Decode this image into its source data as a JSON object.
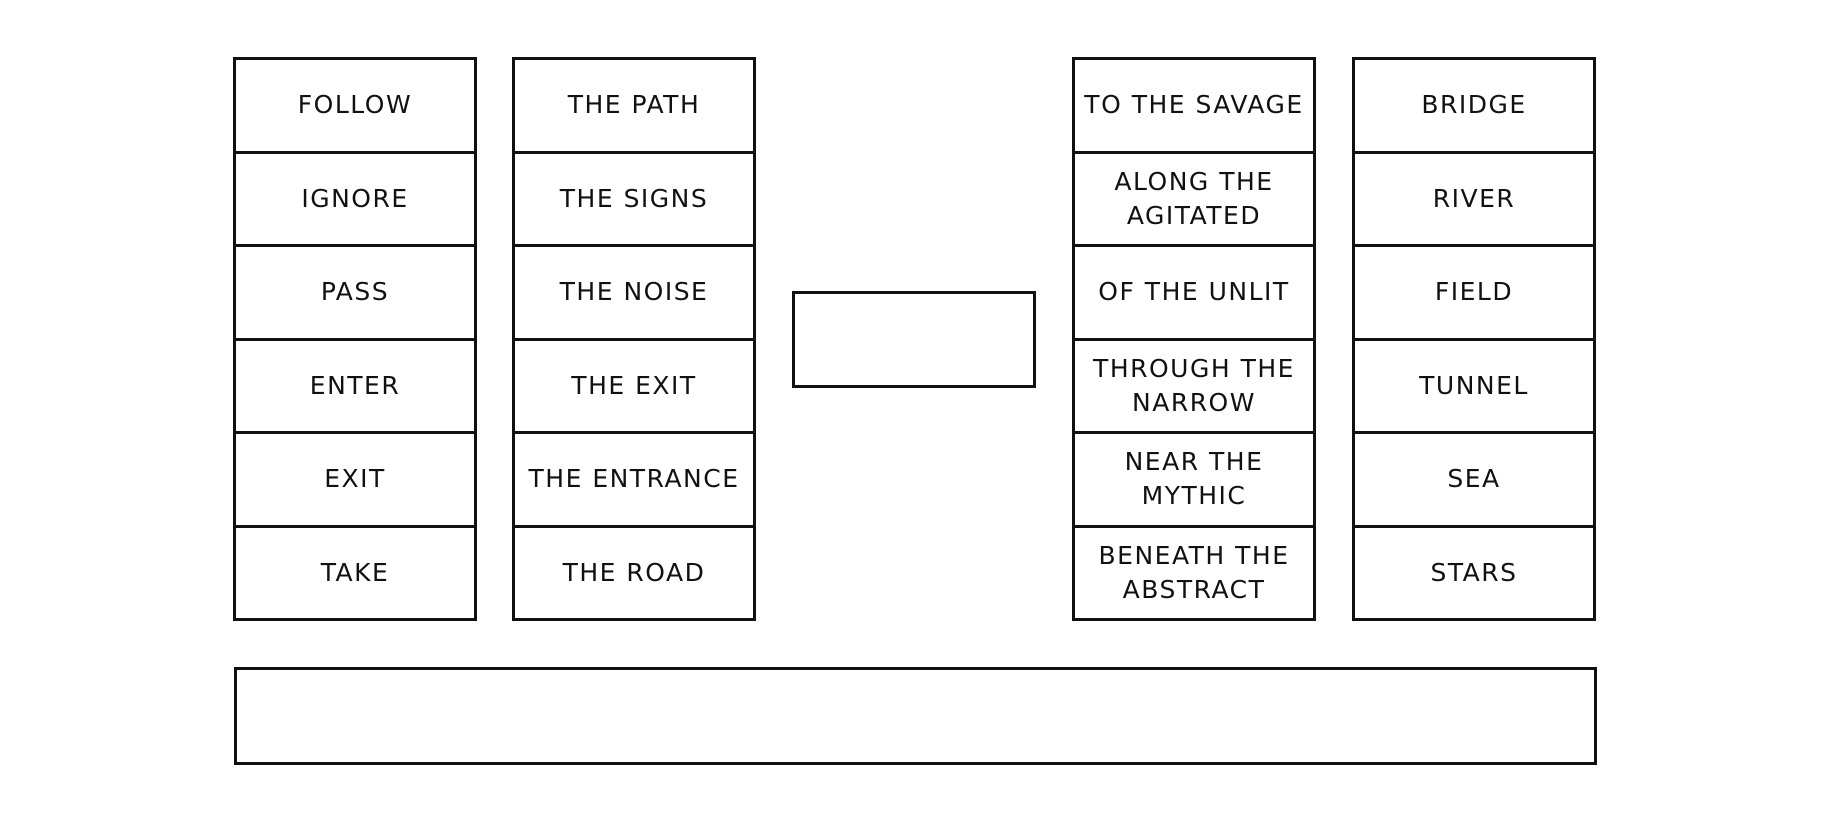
{
  "puzzle": {
    "columns": [
      {
        "id": "verbs",
        "items": [
          "FOLLOW",
          "IGNORE",
          "PASS",
          "ENTER",
          "EXIT",
          "TAKE"
        ]
      },
      {
        "id": "objects",
        "items": [
          "THE PATH",
          "THE SIGNS",
          "THE NOISE",
          "THE EXIT",
          "THE ENTRANCE",
          "THE ROAD"
        ]
      },
      {
        "id": "prepositions",
        "items": [
          "TO THE SAVAGE",
          "ALONG THE AGITATED",
          "OF THE UNLIT",
          "THROUGH THE NARROW",
          "NEAR THE MYTHIC",
          "BENEATH THE ABSTRACT"
        ]
      },
      {
        "id": "places",
        "items": [
          "BRIDGE",
          "RIVER",
          "FIELD",
          "TUNNEL",
          "SEA",
          "STARS"
        ]
      }
    ],
    "middle_slot": {
      "value": ""
    },
    "answer_box": {
      "value": ""
    }
  }
}
